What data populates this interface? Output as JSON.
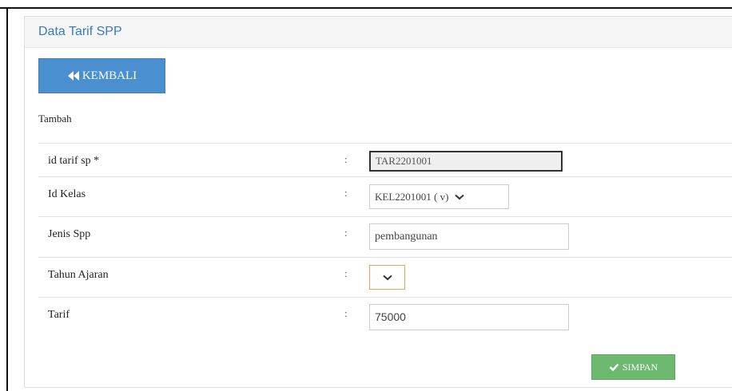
{
  "panel": {
    "title": "Data Tarif SPP"
  },
  "toolbar": {
    "back_label": "KEMBALI",
    "back_icon": "double-chevron-left-icon"
  },
  "form": {
    "section_title": "Tambah",
    "separator": ":",
    "fields": {
      "id_tarif": {
        "label": "id tarif sp *",
        "value": "TAR2201001"
      },
      "id_kelas": {
        "label": "Id Kelas",
        "value": "KEL2201001 ( v)"
      },
      "jenis_spp": {
        "label": "Jenis Spp",
        "value": "pembangunan"
      },
      "tahun_ajaran": {
        "label": "Tahun Ajaran",
        "value": ""
      },
      "tarif": {
        "label": "Tarif",
        "value": "75000"
      }
    },
    "save_label": "SIMPAN",
    "save_icon": "check-icon"
  },
  "colors": {
    "primary": "#4a8fcf",
    "success": "#6cb96f",
    "heading_text": "#3a7bbd",
    "focus_border": "#e8a25a"
  }
}
